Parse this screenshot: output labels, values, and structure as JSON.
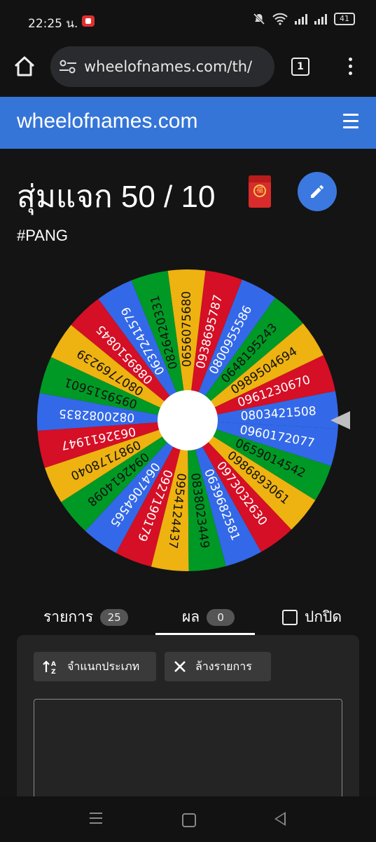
{
  "status": {
    "time": "22:25 น.",
    "battery": "41"
  },
  "browser": {
    "url": "wheelofnames.com/th/",
    "tab_count": "1"
  },
  "site": {
    "brand": "wheelofnames.com"
  },
  "page": {
    "title": "สุ่มแจก 50 / 10",
    "envelope_char": "福",
    "subtitle": "#PANG"
  },
  "wheel": {
    "colors": [
      "#3369e8",
      "#d50f25",
      "#eeb211",
      "#009925"
    ],
    "entries": [
      "0803421508",
      "0961230670",
      "0989504694",
      "0648195243",
      "0800955586",
      "0938695787",
      "0656075680",
      "0826420331",
      "0637241579",
      "0889510845",
      "0807769239",
      "0959515601",
      "0820082835",
      "0632611947",
      "0987178040",
      "0942614098",
      "0647064565",
      "0927190179",
      "0954124437",
      "0838023449",
      "0639682581",
      "0973032630",
      "0986893061",
      "0659014542",
      "0960172077"
    ]
  },
  "tabs": {
    "entries_label": "รายการ",
    "entries_count": "25",
    "results_label": "ผล",
    "results_count": "0",
    "hide_label": "ปกปิด"
  },
  "panel": {
    "sort_label": "จำแนกประเภท",
    "clear_label": "ล้างรายการ"
  }
}
